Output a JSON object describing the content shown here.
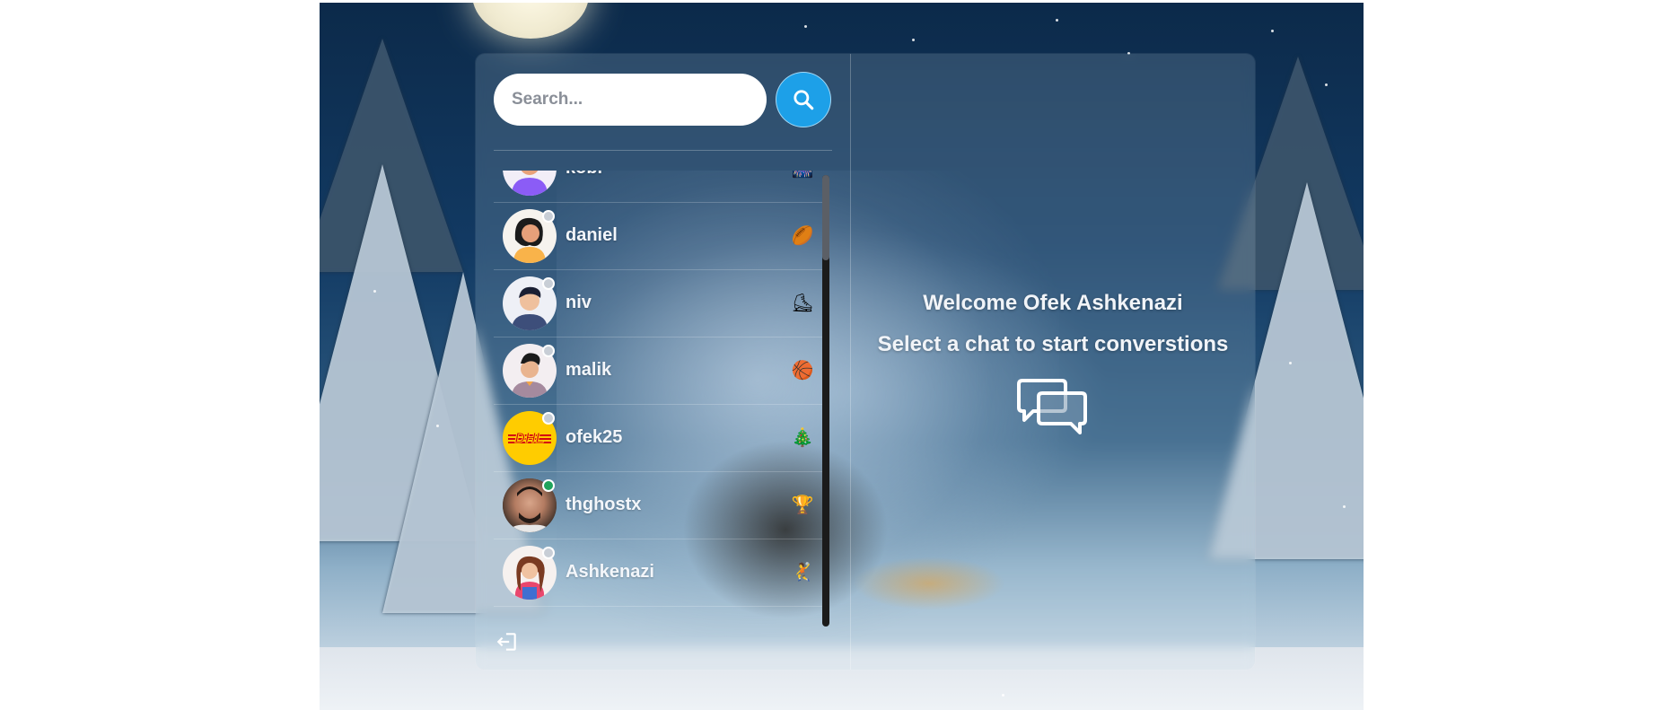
{
  "search": {
    "placeholder": "Search..."
  },
  "users": [
    {
      "name": "kobi",
      "emoji": "🎆",
      "online": false
    },
    {
      "name": "daniel",
      "emoji": "🏉",
      "online": false
    },
    {
      "name": "niv",
      "emoji": "⛸",
      "online": false
    },
    {
      "name": "malik",
      "emoji": "🏀",
      "online": false
    },
    {
      "name": "ofek25",
      "emoji": "🎄",
      "online": false
    },
    {
      "name": "thghostx",
      "emoji": "🏆",
      "online": true
    },
    {
      "name": "Ashkenazi",
      "emoji": "🤾",
      "online": false
    }
  ],
  "welcome": {
    "title": "Welcome Ofek Ashkenazi",
    "subtitle": "Select a chat to start converstions"
  },
  "avatar_logo_text": "DHL",
  "colors": {
    "accent": "#1da0e8",
    "online": "#1fa35b",
    "offline": "#c8ced6",
    "dhl_yellow": "#ffcc00",
    "dhl_red": "#d40511"
  }
}
